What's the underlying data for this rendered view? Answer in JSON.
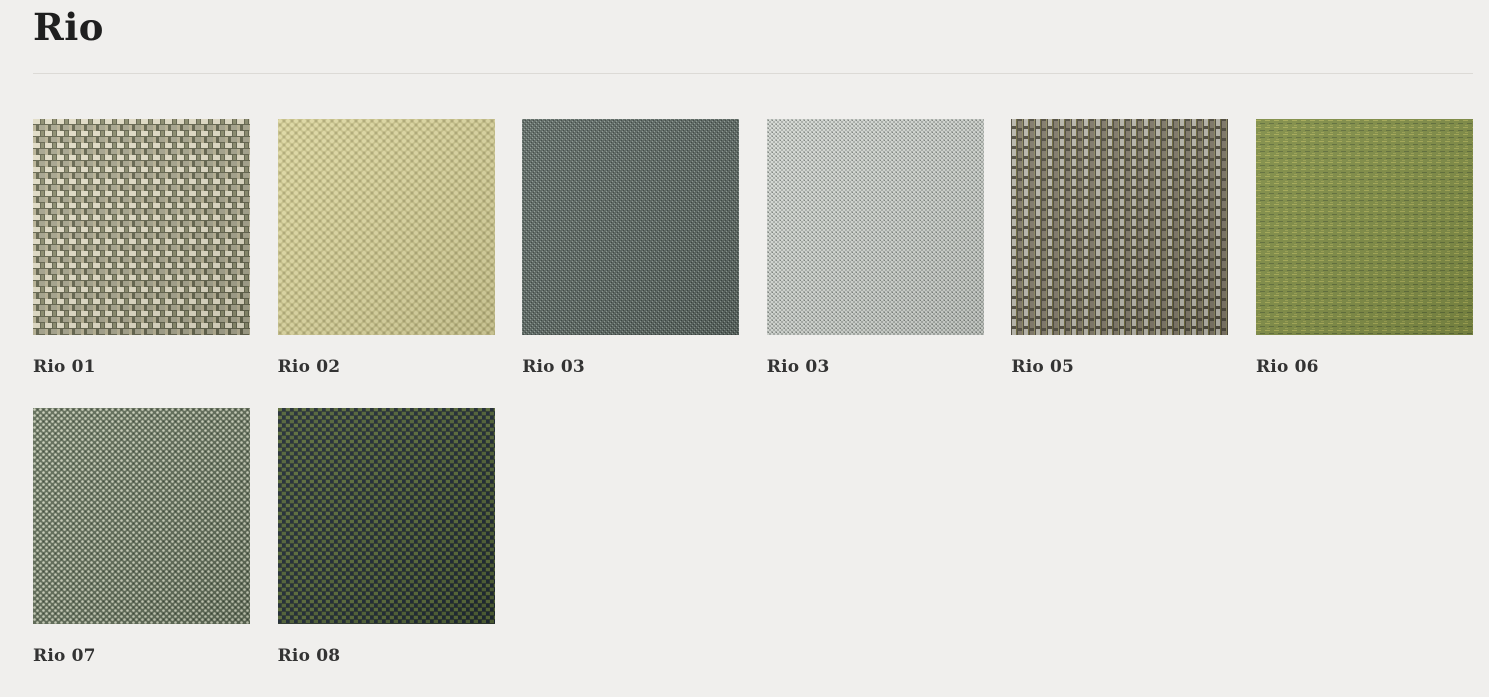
{
  "page": {
    "title": "Rio"
  },
  "swatches": [
    {
      "label": "Rio 01",
      "base": "#a7a58e",
      "pattern": "basket",
      "fg": "#e1dcc6",
      "dark": "#65664f"
    },
    {
      "label": "Rio 02",
      "base": "#c5bf88",
      "pattern": "boucle",
      "fg": "#ddd7a2",
      "dark": "#9a9463"
    },
    {
      "label": "Rio 03",
      "base": "#5c6762",
      "pattern": "tweed",
      "fg": "#8e9a94",
      "dark": "#3c4541"
    },
    {
      "label": "Rio 03",
      "base": "#a9aea9",
      "pattern": "fine",
      "fg": "#d4d8d3",
      "dark": "#7d837e"
    },
    {
      "label": "Rio 05",
      "base": "#80796a",
      "pattern": "stripe",
      "fg": "#b8b6ab",
      "dark": "#4f4b3f"
    },
    {
      "label": "Rio 06",
      "base": "#7f8c45",
      "pattern": "melange",
      "fg": "#a5a955",
      "dark": "#5f6d3a"
    },
    {
      "label": "Rio 07",
      "base": "#5f6b57",
      "pattern": "dots",
      "fg": "#c8cdb8",
      "dark": "#3f4a3b"
    },
    {
      "label": "Rio 08",
      "base": "#2f3a2f",
      "pattern": "weave",
      "fg": "#5a6b3a",
      "dark": "#1f2a35"
    }
  ]
}
